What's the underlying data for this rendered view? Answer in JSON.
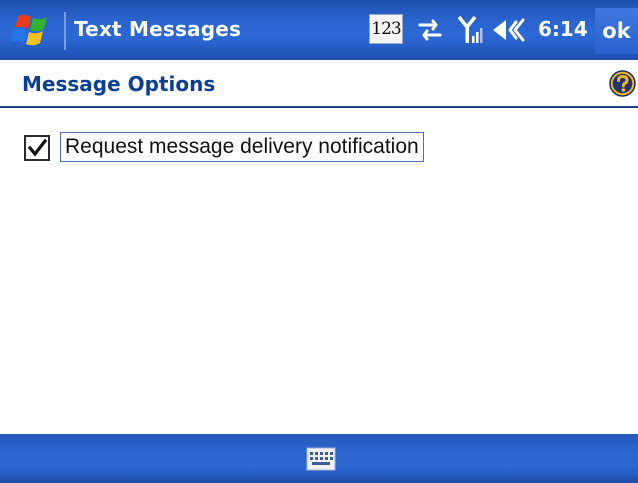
{
  "titlebar": {
    "app_title": "Text Messages",
    "input_mode": "123",
    "clock": "6:14",
    "ok_label": "ok",
    "icons": [
      "windows-start-icon",
      "input-mode-icon",
      "data-connection-icon",
      "signal-strength-icon",
      "volume-icon"
    ]
  },
  "header": {
    "title": "Message Options",
    "help_icon": "help-icon"
  },
  "options": {
    "delivery_notification": {
      "label": "Request message delivery notification",
      "checked": true
    }
  },
  "bottombar": {
    "sip_icon": "keyboard-icon"
  },
  "colors": {
    "titlebar": "#2a64cf",
    "header_text": "#0b3f95",
    "bottombar": "#2b65cf",
    "background": "#ffffff"
  }
}
